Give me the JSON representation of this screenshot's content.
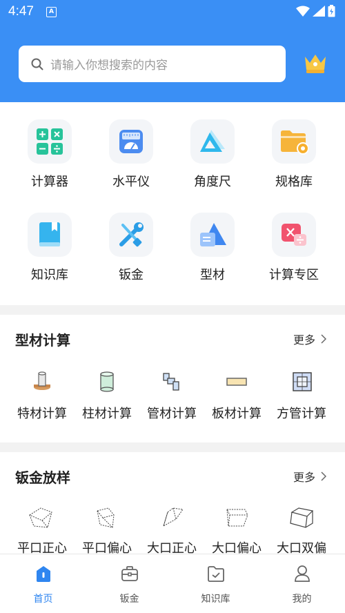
{
  "status": {
    "time": "4:47"
  },
  "search": {
    "placeholder": "请输入你想搜索的内容"
  },
  "tools": [
    {
      "label": "计算器",
      "icon": "calculator-icon"
    },
    {
      "label": "水平仪",
      "icon": "level-icon"
    },
    {
      "label": "角度尺",
      "icon": "protractor-icon"
    },
    {
      "label": "规格库",
      "icon": "folder-settings-icon"
    },
    {
      "label": "知识库",
      "icon": "book-icon"
    },
    {
      "label": "钣金",
      "icon": "wrench-icon"
    },
    {
      "label": "型材",
      "icon": "shape-icon"
    },
    {
      "label": "计算专区",
      "icon": "math-card-icon"
    }
  ],
  "profile_section": {
    "title": "型材计算",
    "more": "更多",
    "items": [
      {
        "label": "特材计算",
        "icon": "special-material-icon"
      },
      {
        "label": "柱材计算",
        "icon": "cylinder-icon"
      },
      {
        "label": "管材计算",
        "icon": "pipe-icon"
      },
      {
        "label": "板材计算",
        "icon": "plate-icon"
      },
      {
        "label": "方管计算",
        "icon": "square-tube-icon"
      }
    ]
  },
  "sheet_section": {
    "title": "钣金放样",
    "more": "更多",
    "items": [
      {
        "label": "平口正心",
        "icon": "flat-center-icon"
      },
      {
        "label": "平口偏心",
        "icon": "flat-offset-icon"
      },
      {
        "label": "大口正心",
        "icon": "big-center-icon"
      },
      {
        "label": "大口偏心",
        "icon": "big-offset-icon"
      },
      {
        "label": "大口双偏",
        "icon": "big-double-offset-icon"
      }
    ]
  },
  "nav": [
    {
      "label": "首页",
      "icon": "home-icon",
      "active": true
    },
    {
      "label": "钣金",
      "icon": "toolbox-icon",
      "active": false
    },
    {
      "label": "知识库",
      "icon": "folder-check-icon",
      "active": false
    },
    {
      "label": "我的",
      "icon": "user-icon",
      "active": false
    }
  ],
  "colors": {
    "primary": "#3a8ff5",
    "active_nav": "#2f86f0"
  }
}
